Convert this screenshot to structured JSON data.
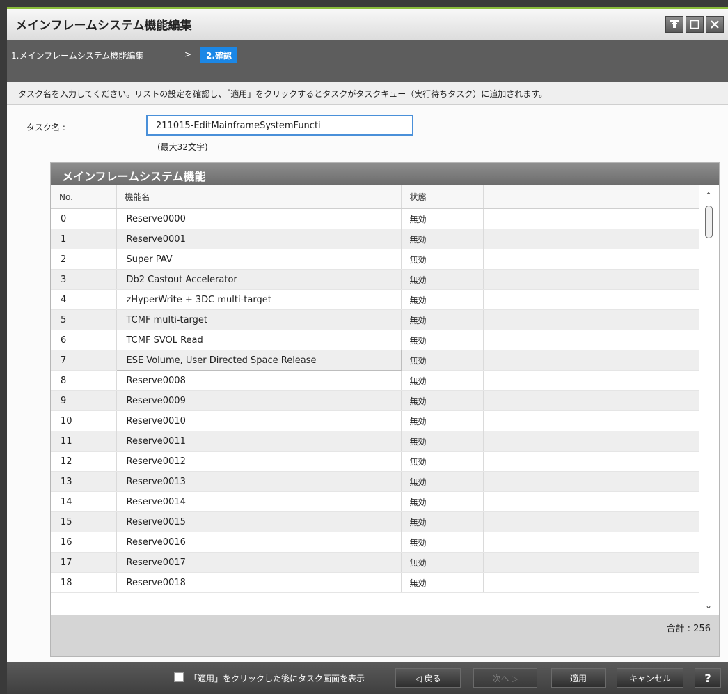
{
  "window": {
    "title": "メインフレームシステム機能編集",
    "buttons": [
      "pin-icon",
      "maximize-icon",
      "close-icon"
    ]
  },
  "steps": {
    "step1": "1.メインフレームシステム機能編集",
    "separator": ">",
    "step2": "2.確認"
  },
  "instructions": "タスク名を入力してください。リストの設定を確認し、「適用」をクリックするとタスクがタスクキュー（実行待ちタスク）に追加されます。",
  "task": {
    "label": "タスク名 :",
    "value": "211015-EditMainframeSystemFuncti",
    "hint": "(最大32文字)"
  },
  "panel": {
    "title": "メインフレームシステム機能",
    "columns": [
      "No.",
      "機能名",
      "状態",
      ""
    ],
    "rows": [
      {
        "no": "0",
        "name": "Reserve0000",
        "state": "無効"
      },
      {
        "no": "1",
        "name": "Reserve0001",
        "state": "無効"
      },
      {
        "no": "2",
        "name": "Super PAV",
        "state": "無効"
      },
      {
        "no": "3",
        "name": "Db2 Castout Accelerator",
        "state": "無効"
      },
      {
        "no": "4",
        "name": "zHyperWrite + 3DC multi-target",
        "state": "無効"
      },
      {
        "no": "5",
        "name": "TCMF multi-target",
        "state": "無効"
      },
      {
        "no": "6",
        "name": "TCMF SVOL Read",
        "state": "無効"
      },
      {
        "no": "7",
        "name": "ESE Volume, User Directed Space Release",
        "state": "無効"
      },
      {
        "no": "8",
        "name": "Reserve0008",
        "state": "無効"
      },
      {
        "no": "9",
        "name": "Reserve0009",
        "state": "無効"
      },
      {
        "no": "10",
        "name": "Reserve0010",
        "state": "無効"
      },
      {
        "no": "11",
        "name": "Reserve0011",
        "state": "無効"
      },
      {
        "no": "12",
        "name": "Reserve0012",
        "state": "無効"
      },
      {
        "no": "13",
        "name": "Reserve0013",
        "state": "無効"
      },
      {
        "no": "14",
        "name": "Reserve0014",
        "state": "無効"
      },
      {
        "no": "15",
        "name": "Reserve0015",
        "state": "無効"
      },
      {
        "no": "16",
        "name": "Reserve0016",
        "state": "無効"
      },
      {
        "no": "17",
        "name": "Reserve0017",
        "state": "無効"
      },
      {
        "no": "18",
        "name": "Reserve0018",
        "state": "無効"
      }
    ],
    "total": "合計 :  256"
  },
  "footer": {
    "checkbox_label": "「適用」をクリックした後にタスク画面を表示",
    "back": "◁ 戻る",
    "next": "次へ ▷",
    "apply": "適用",
    "cancel": "キャンセル",
    "help": "?"
  },
  "colors": {
    "accent": "#1b87e6",
    "title_border": "#8bbd3c",
    "header_bar": "#5d5d5d"
  }
}
